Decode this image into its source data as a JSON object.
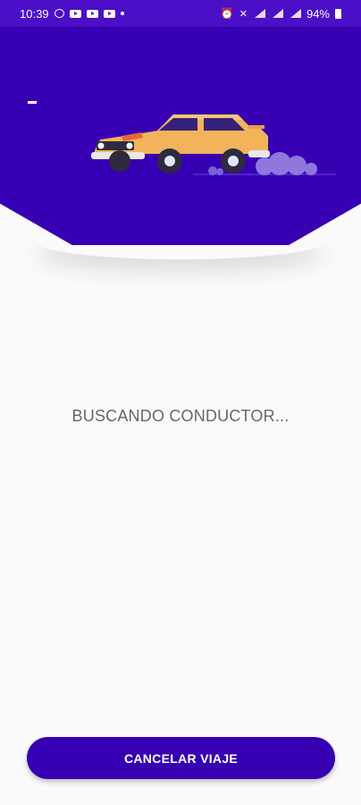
{
  "status_bar": {
    "time": "10:39",
    "battery_percent": "94%",
    "icons": [
      "chat-icon",
      "youtube-icon",
      "youtube-icon",
      "youtube-icon",
      "dot-icon",
      "alarm-icon",
      "mute-icon",
      "wifi-icon",
      "signal-icon",
      "signal-icon",
      "battery-icon"
    ]
  },
  "header": {
    "background_color": "#3700b3",
    "illustration": "car-icon"
  },
  "main": {
    "status_text": "BUSCANDO CONDUCTOR..."
  },
  "actions": {
    "cancel_label": "CANCELAR VIAJE"
  },
  "colors": {
    "primary": "#3700b3",
    "status_bar": "#4a0fc6",
    "car_body": "#f2b45a",
    "background": "#fafafa",
    "text_muted": "#666666"
  }
}
